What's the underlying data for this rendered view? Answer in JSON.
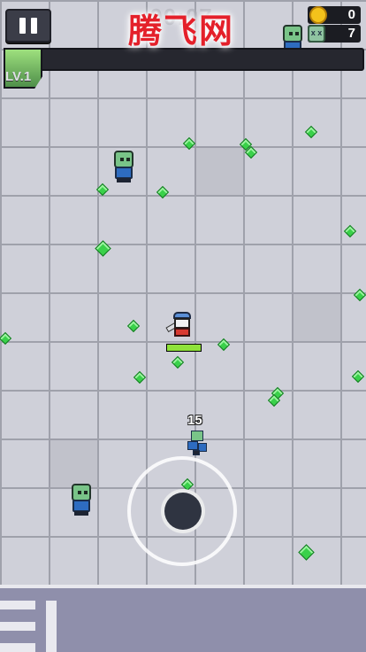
{
  "hud": {
    "timer": "00:07",
    "watermark": "腾飞网",
    "level_label": "LV.1",
    "coins": "0",
    "kills": "7",
    "xp_progress": 0.1,
    "pause_icon": "pause-icon",
    "coin_icon": "coin-icon",
    "kills_icon": "skull-icon"
  },
  "player": {
    "health_fraction": 1.0,
    "damage_popup": "15"
  },
  "colors": {
    "floor": "#cfd0d9",
    "grid_line": "#9fa1ab",
    "gem": "#3ad14a",
    "xp_fill": "#8fe23a",
    "watermark": "#e4202a"
  },
  "controls": {
    "joystick": "virtual-joystick"
  }
}
